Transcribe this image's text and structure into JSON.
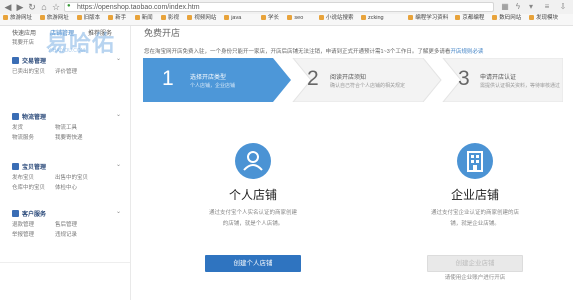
{
  "browser": {
    "url": "https://openshop.taobao.com/index.htm",
    "bookmarks": [
      "旅游网址",
      "旅游网址",
      "旧版本",
      "新手",
      "新闻",
      "影视",
      "视频网站",
      "java",
      "学长",
      "seo",
      "小说站搜索",
      "zcking",
      "编程学习资料",
      "京都编程",
      "数码网站",
      "发现模块"
    ]
  },
  "sidebar": {
    "header_links": [
      "快速应用",
      "店铺管理",
      "推荐服务"
    ],
    "header_sub": "我要开店",
    "sections": [
      {
        "title": "交易管理",
        "links": [
          "已卖出的宝贝",
          "评价管理"
        ]
      },
      {
        "title": "物流管理",
        "links": [
          "发货",
          "物流工具",
          "物流服务",
          "我要寄快递"
        ]
      },
      {
        "title": "宝贝管理",
        "links": [
          "发布宝贝",
          "出售中的宝贝",
          "仓库中的宝贝",
          "体检中心"
        ]
      },
      {
        "title": "客户服务",
        "links": [
          "退款管理",
          "售后管理",
          "举报管理",
          "违规记录"
        ]
      }
    ]
  },
  "main": {
    "page_title": "免费开店",
    "notice": "您在淘宝网开店免费入驻，一个身份只能开一家店，开店后店铺无法注销，申请到正式开通预计需1~3个工作日。了解更多请看开店规则必读",
    "notice_link": "开店规则必读",
    "steps": [
      {
        "num": "1",
        "title": "选择开店类型",
        "sub": "个人店铺，企业店铺"
      },
      {
        "num": "2",
        "title": "阅读开店须知",
        "sub": "确认自己符合个人店铺的相关规定"
      },
      {
        "num": "3",
        "title": "申请开店认证",
        "sub": "需提供认证相关资料，等待审核通过"
      }
    ],
    "cards": [
      {
        "title": "个人店铺",
        "desc_lines": [
          "通过支付宝个人实名认证的商家创建",
          "的店铺，就是个人店铺。"
        ],
        "button": "创建个人店铺"
      },
      {
        "title": "企业店铺",
        "desc_lines": [
          "通过支付宝企业认证的商家创建的店",
          "铺，就是企业店铺。"
        ],
        "button": "创建企业店铺",
        "footnote": "请使用企业账户进行开店"
      }
    ]
  },
  "watermark": {
    "text": "易哈佑",
    "sub": "YIHAIYOU.COM"
  },
  "colors": {
    "accent": "#3b7fc4",
    "step_active": "#4d97d8",
    "icon_bg": "#4b93d4",
    "disabled": "#d2d2d2"
  }
}
